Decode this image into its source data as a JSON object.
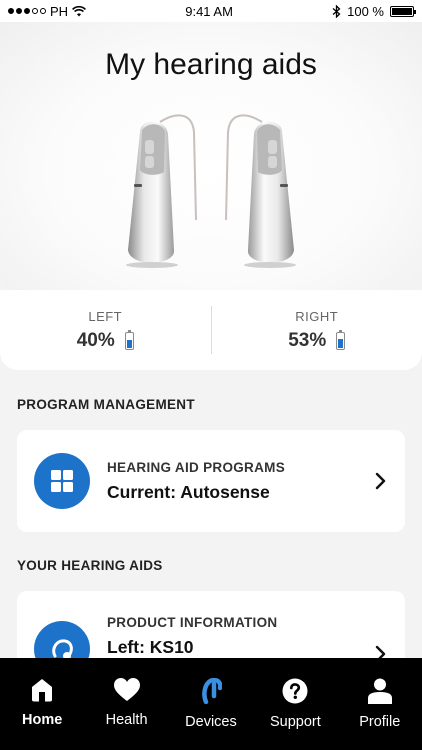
{
  "status_bar": {
    "carrier": "PH",
    "time": "9:41 AM",
    "battery": "100 %"
  },
  "hero": {
    "title": "My hearing aids"
  },
  "battery": {
    "left": {
      "label": "LEFT",
      "value": "40%",
      "level": 0.4
    },
    "right": {
      "label": "RIGHT",
      "value": "53%",
      "level": 0.53
    }
  },
  "program_section": {
    "title": "PROGRAM MANAGEMENT",
    "card": {
      "caption": "HEARING AID PROGRAMS",
      "value": "Current: Autosense",
      "icon": "grid-icon"
    }
  },
  "aids_section": {
    "title": "YOUR HEARING AIDS",
    "card": {
      "caption": "PRODUCT INFORMATION",
      "value": "Left: KS10",
      "icon": "hearing-aid-icon"
    }
  },
  "tabs": [
    {
      "label": "Home",
      "icon": "home-icon",
      "active": true
    },
    {
      "label": "Health",
      "icon": "heart-icon",
      "active": false
    },
    {
      "label": "Devices",
      "icon": "device-icon",
      "active": false
    },
    {
      "label": "Support",
      "icon": "help-icon",
      "active": false
    },
    {
      "label": "Profile",
      "icon": "person-icon",
      "active": false
    }
  ],
  "colors": {
    "accent": "#1d73c9",
    "tab_bar": "#000000",
    "device_blue": "#3a8fe0"
  }
}
